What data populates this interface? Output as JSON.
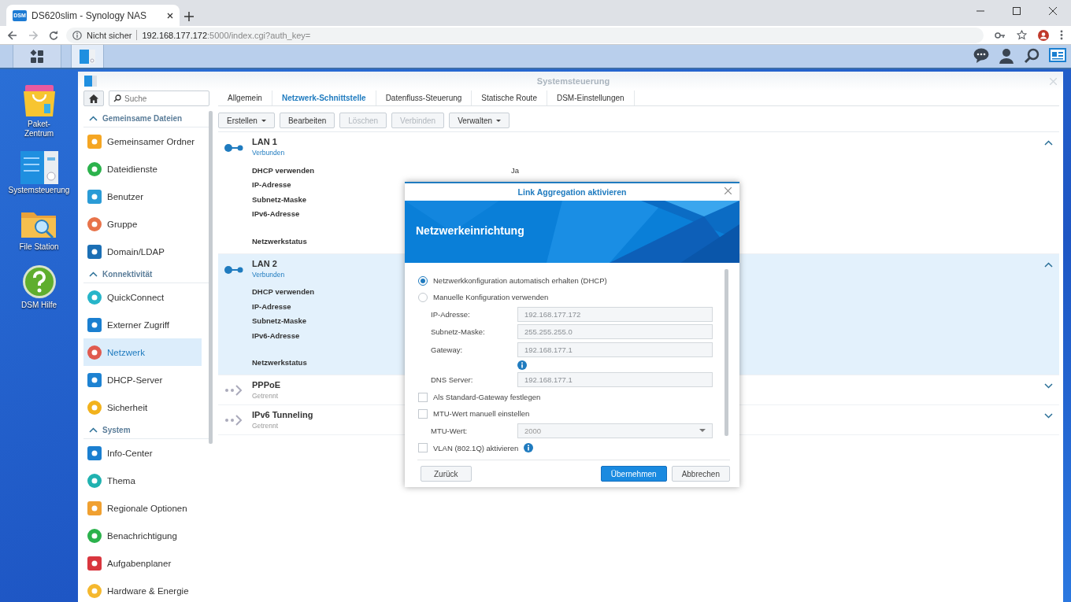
{
  "browser": {
    "tab": {
      "favicon": "DSM",
      "title": "DS620slim - Synology NAS"
    },
    "security": "Nicht sicher",
    "url_host": "192.168.177.172",
    "url_path": ":5000/index.cgi?auth_key="
  },
  "desktop_icons": [
    {
      "kind": "package",
      "label": "Paket-Zentrum"
    },
    {
      "kind": "control-panel",
      "label": "Systemsteuerung"
    },
    {
      "kind": "folder",
      "label": "File Station"
    },
    {
      "kind": "help",
      "label": "DSM Hilfe"
    }
  ],
  "window": {
    "title": "Systemsteuerung",
    "search": {
      "placeholder": "Suche"
    },
    "sidebar": [
      {
        "heading": "Gemeinsame Dateien",
        "expanded": true,
        "items": [
          {
            "label": "Gemeinsamer Ordner",
            "selected": false
          },
          {
            "label": "Dateidienste",
            "selected": false
          },
          {
            "label": "Benutzer",
            "selected": false
          },
          {
            "label": "Gruppe",
            "selected": false
          },
          {
            "label": "Domain/LDAP",
            "selected": false
          }
        ]
      },
      {
        "heading": "Konnektivität",
        "expanded": true,
        "items": [
          {
            "label": "QuickConnect",
            "selected": false
          },
          {
            "label": "Externer Zugriff",
            "selected": false
          },
          {
            "label": "Netzwerk",
            "selected": true
          },
          {
            "label": "DHCP-Server",
            "selected": false
          },
          {
            "label": "Sicherheit",
            "selected": false
          }
        ]
      },
      {
        "heading": "System",
        "expanded": true,
        "items": [
          {
            "label": "Info-Center",
            "selected": false
          },
          {
            "label": "Thema",
            "selected": false
          },
          {
            "label": "Regionale Optionen",
            "selected": false
          },
          {
            "label": "Benachrichtigung",
            "selected": false
          },
          {
            "label": "Aufgabenplaner",
            "selected": false
          },
          {
            "label": "Hardware & Energie",
            "selected": false
          }
        ]
      }
    ],
    "tabs": [
      {
        "label": "Allgemein",
        "selected": false
      },
      {
        "label": "Netzwerk-Schnittstelle",
        "selected": true
      },
      {
        "label": "Datenfluss-Steuerung",
        "selected": false
      },
      {
        "label": "Statische Route",
        "selected": false
      },
      {
        "label": "DSM-Einstellungen",
        "selected": false
      }
    ],
    "toolbar": [
      {
        "label": "Erstellen",
        "dropdown": true,
        "disabled": false
      },
      {
        "label": "Bearbeiten",
        "dropdown": false,
        "disabled": false
      },
      {
        "label": "Löschen",
        "dropdown": false,
        "disabled": true
      },
      {
        "label": "Verbinden",
        "dropdown": false,
        "disabled": true
      },
      {
        "label": "Verwalten",
        "dropdown": true,
        "disabled": false
      }
    ],
    "interfaces": [
      {
        "name": "LAN 1",
        "status": "Verbunden",
        "connected": true,
        "expanded": true,
        "selected": false,
        "fields": [
          {
            "label": "DHCP verwenden",
            "value": "Ja"
          },
          {
            "label": "IP-Adresse"
          },
          {
            "label": "Subnetz-Maske"
          },
          {
            "label": "IPv6-Adresse"
          },
          {
            "label": "Netzwerkstatus"
          }
        ]
      },
      {
        "name": "LAN 2",
        "status": "Verbunden",
        "connected": true,
        "expanded": true,
        "selected": true,
        "fields": [
          {
            "label": "DHCP verwenden"
          },
          {
            "label": "IP-Adresse"
          },
          {
            "label": "Subnetz-Maske"
          },
          {
            "label": "IPv6-Adresse"
          },
          {
            "label": "Netzwerkstatus"
          }
        ]
      },
      {
        "name": "PPPoE",
        "status": "Getrennt",
        "connected": false,
        "expanded": false,
        "selected": false
      },
      {
        "name": "IPv6 Tunneling",
        "status": "Getrennt",
        "connected": false,
        "expanded": false,
        "selected": false
      }
    ]
  },
  "dialog": {
    "title": "Link Aggregation aktivieren",
    "heading": "Netzwerkeinrichtung",
    "form": [
      {
        "kind": "radio",
        "label": "Netzwerkkonfiguration automatisch erhalten (DHCP)",
        "selected": true
      },
      {
        "kind": "radio",
        "label": "Manuelle Konfiguration verwenden",
        "selected": false
      },
      {
        "kind": "field",
        "label": "IP-Adresse:",
        "value": "192.168.177.172",
        "disabled": true
      },
      {
        "kind": "field",
        "label": "Subnetz-Maske:",
        "value": "255.255.255.0",
        "disabled": true
      },
      {
        "kind": "field",
        "label": "Gateway:",
        "value": "192.168.177.1",
        "disabled": true,
        "info": true
      },
      {
        "kind": "field",
        "label": "DNS Server:",
        "value": "192.168.177.1",
        "disabled": true
      },
      {
        "kind": "checkbox",
        "label": "Als Standard-Gateway festlegen",
        "checked": false
      },
      {
        "kind": "checkbox",
        "label": "MTU-Wert manuell einstellen",
        "checked": false
      },
      {
        "kind": "select",
        "label": "MTU-Wert:",
        "value": "2000",
        "disabled": true
      },
      {
        "kind": "checkbox",
        "label": "VLAN (802.1Q) aktivieren",
        "checked": false,
        "info": true
      }
    ],
    "buttons": [
      {
        "label": "Zurück",
        "kind": "back"
      },
      {
        "label": "Übernehmen",
        "kind": "primary"
      },
      {
        "label": "Abbrechen",
        "kind": "secondary"
      }
    ]
  }
}
